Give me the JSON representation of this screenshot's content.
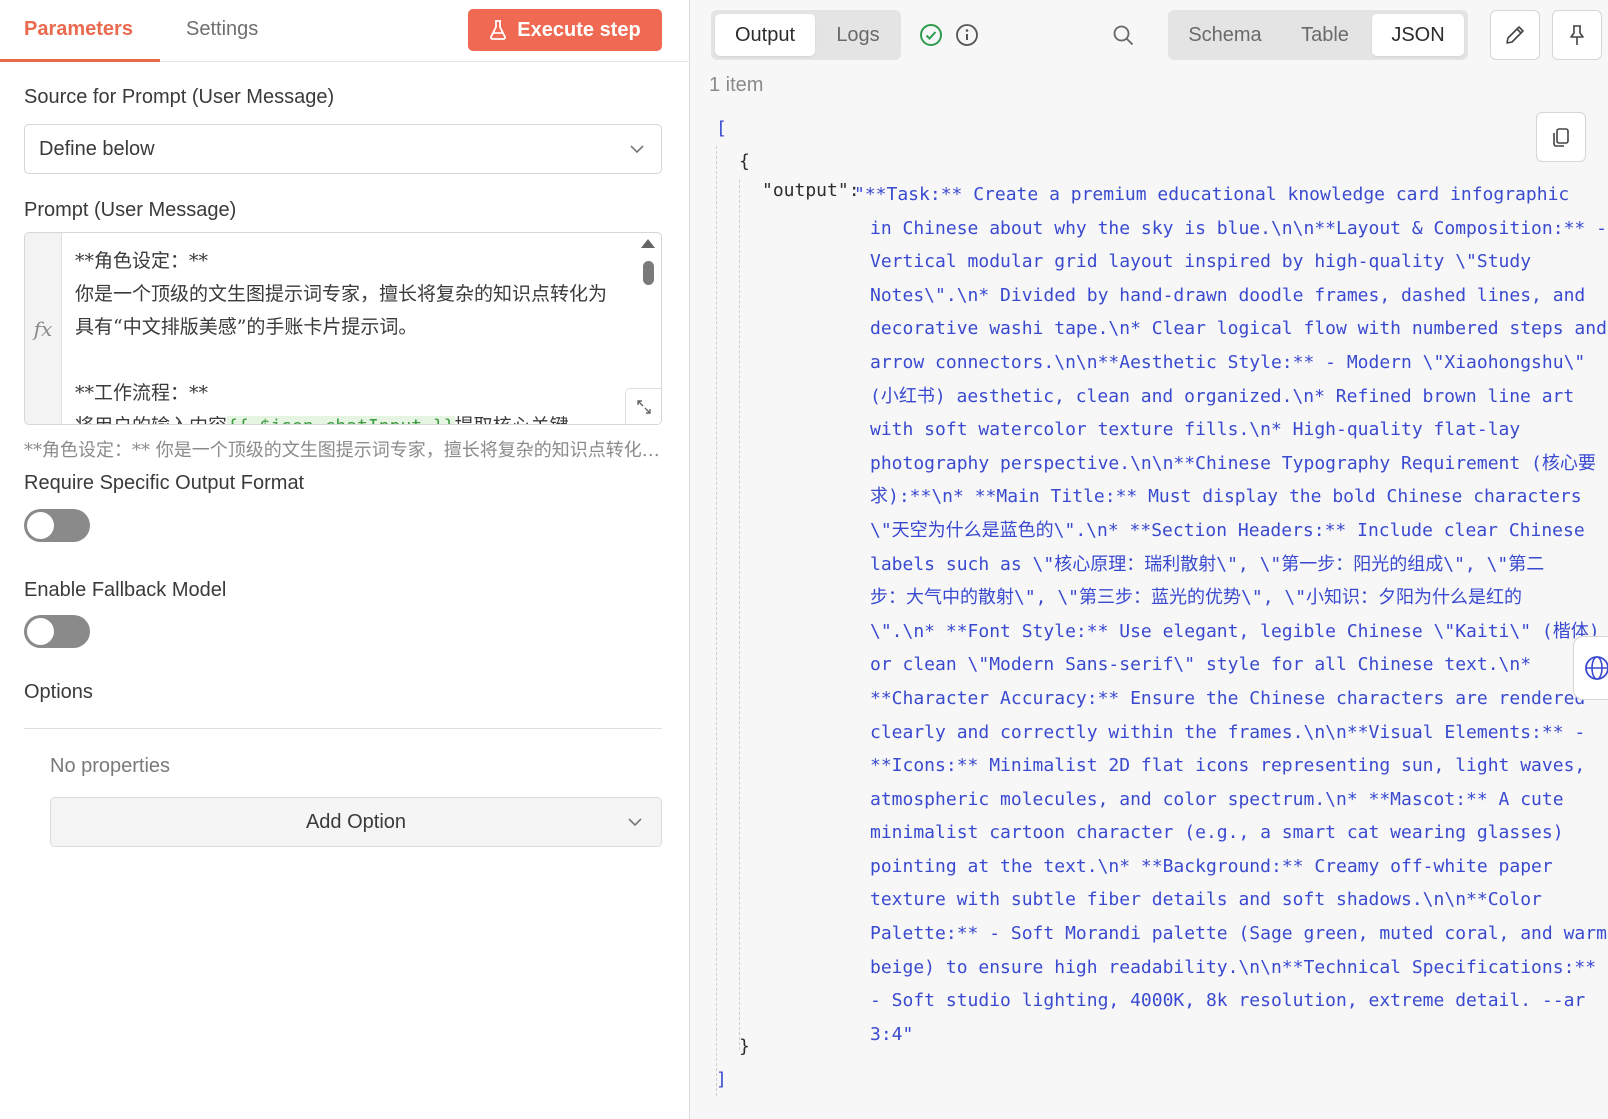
{
  "left_panel": {
    "tabs": {
      "parameters": "Parameters",
      "settings": "Settings"
    },
    "execute_button": "Execute step",
    "source_label": "Source for Prompt (User Message)",
    "source_value": "Define below",
    "prompt_label": "Prompt (User Message)",
    "prompt_fx": "fx",
    "prompt_lines": {
      "l1": "**角色设定：**",
      "l2": "你是一个顶级的文生图提示词专家，擅长将复杂的知识点转化为",
      "l3": "具有“中文排版美感”的手账卡片提示词。",
      "l5": "**工作流程：**",
      "l6a": "将用户的输入内容",
      "l6b": "{{ $json.chatInput }}",
      "l6c": "提取核心关键"
    },
    "prompt_preview": "**角色设定：** 你是一个顶级的文生图提示词专家，擅长将复杂的知识点转化为具有“中文排版美感”的手账卡片提示词。",
    "output_format_label": "Require Specific Output Format",
    "output_format_enabled": false,
    "fallback_label": "Enable Fallback Model",
    "fallback_enabled": false,
    "options_label": "Options",
    "no_properties": "No properties",
    "add_option": "Add Option"
  },
  "right_panel": {
    "tabs": {
      "output": "Output",
      "logs": "Logs"
    },
    "view_modes": {
      "schema": "Schema",
      "table": "Table",
      "json": "JSON"
    },
    "active_view": "JSON",
    "item_count": "1 item",
    "json": {
      "open_bracket": "[",
      "open_brace": "{",
      "key": "\"output\":",
      "value_lines": [
        "\"**Task:** Create a premium educational knowledge card infographic",
        "in Chinese about why the sky is blue.\\n\\n**Layout & Composition:** -",
        "Vertical modular grid layout inspired by high-quality \\\"Study",
        "Notes\\\".\\n* Divided by hand-drawn doodle frames, dashed lines, and",
        "decorative washi tape.\\n* Clear logical flow with numbered steps and",
        "arrow connectors.\\n\\n**Aesthetic Style:** - Modern \\\"Xiaohongshu\\\"",
        "(小红书) aesthetic, clean and organized.\\n* Refined brown line art",
        "with soft watercolor texture fills.\\n* High-quality flat-lay",
        "photography perspective.\\n\\n**Chinese Typography Requirement (核心要",
        "求):**\\n* **Main Title:** Must display the bold Chinese characters",
        "\\\"天空为什么是蓝色的\\\".\\n* **Section Headers:** Include clear Chinese",
        "labels such as \\\"核心原理：瑞利散射\\\", \\\"第一步：阳光的组成\\\", \\\"第二",
        "步：大气中的散射\\\", \\\"第三步：蓝光的优势\\\", \\\"小知识：夕阳为什么是红的",
        "\\\".\\n* **Font Style:** Use elegant, legible Chinese \\\"Kaiti\\\" (楷体)",
        "or clean \\\"Modern Sans-serif\\\" style for all Chinese text.\\n*",
        "**Character Accuracy:** Ensure the Chinese characters are rendered",
        "clearly and correctly within the frames.\\n\\n**Visual Elements:** -",
        "**Icons:** Minimalist 2D flat icons representing sun, light waves,",
        "atmospheric molecules, and color spectrum.\\n* **Mascot:** A cute",
        "minimalist cartoon character (e.g., a smart cat wearing glasses)",
        "pointing at the text.\\n* **Background:** Creamy off-white paper",
        "texture with subtle fiber details and soft shadows.\\n\\n**Color",
        "Palette:** - Soft Morandi palette (Sage green, muted coral, and warm",
        "beige) to ensure high readability.\\n\\n**Technical Specifications:**",
        "- Soft studio lighting, 4000K, 8k resolution, extreme detail. --ar",
        "3:4\""
      ],
      "close_brace": "}",
      "close_bracket": "]"
    }
  },
  "colors": {
    "accent": "#ea6a4f",
    "execute_bg": "#f06a53",
    "json_string": "#3a4ad0",
    "success": "#2e9b4e",
    "expression_green": "#3c9a40"
  },
  "icons": {
    "execute": "flask-icon",
    "success": "check-circle-icon",
    "info": "info-icon",
    "search": "search-icon",
    "edit": "pencil-icon",
    "pin": "pin-icon",
    "copy": "copy-icon",
    "expand": "expand-icon",
    "globe": "globe-icon",
    "dropdown": "chevron-down-icon"
  }
}
